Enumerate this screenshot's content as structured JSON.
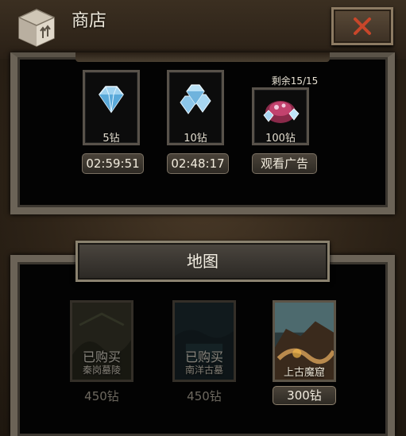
{
  "header": {
    "title": "商店"
  },
  "colors": {
    "close_x": "#c8462a",
    "accent_gold": "#d9a35a"
  },
  "diamond_offers": [
    {
      "amount_label": "5钻",
      "button_label": "02:59:51",
      "icon": "diamond-icon"
    },
    {
      "amount_label": "10钻",
      "button_label": "02:48:17",
      "icon": "diamond-pile-icon"
    },
    {
      "amount_label": "100钻",
      "button_label": "观看广告",
      "remaining": "剩余15/15",
      "icon": "diamond-bag-icon"
    }
  ],
  "map_section": {
    "title": "地图",
    "maps": [
      {
        "status": "已购买",
        "name": "秦岗墓陵",
        "price": "450钻"
      },
      {
        "status": "已购买",
        "name": "南洋古墓",
        "price": "450钻"
      },
      {
        "status": "",
        "name": "上古魔窟",
        "price": "300钻"
      }
    ]
  }
}
